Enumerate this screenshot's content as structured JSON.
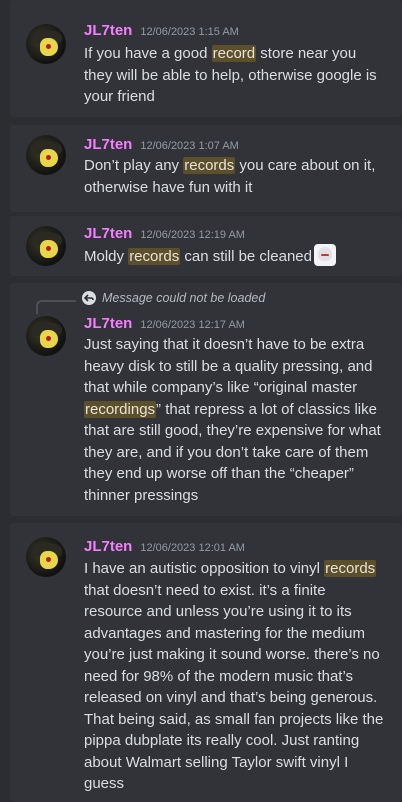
{
  "messages": [
    {
      "author": "JL7ten",
      "timestamp": "12/06/2023 1:15 AM",
      "text_parts": [
        "If you have a good ",
        "record",
        " store near you they will be able to help, otherwise google is your friend"
      ]
    },
    {
      "author": "JL7ten",
      "timestamp": "12/06/2023 1:07 AM",
      "text_parts": [
        "Don’t play any ",
        "records",
        " you care about on it, otherwise have fun with it"
      ]
    },
    {
      "author": "JL7ten",
      "timestamp": "12/06/2023 12:19 AM",
      "text_parts": [
        "Moldy ",
        "records",
        " can still be cleaned"
      ],
      "emoji": "anime-girl-emoji"
    },
    {
      "reply_text": "Message could not be loaded",
      "author": "JL7ten",
      "timestamp": "12/06/2023 12:17 AM",
      "text_parts": [
        "Just saying that it doesn’t have to be extra heavy disk to still be a quality pressing, and that while company’s like “original master ",
        "recordings",
        "” that repress a lot of classics like that are still good, they’re expensive for what they are, and if you don’t take care of them they end up worse off than the “cheaper” thinner pressings"
      ]
    },
    {
      "author": "JL7ten",
      "timestamp": "12/06/2023 12:01 AM",
      "text_parts": [
        "I have an autistic opposition to vinyl ",
        "records",
        " that doesn’t need to exist. it’s a finite resource and unless you’re using it to its advantages and mastering for the medium you’re just making it sound worse. there’s no need for 98% of the modern music that’s released on vinyl and that’s being generous. That being said, as small fan projects like the pippa dubplate its really cool. Just ranting about Walmart selling Taylor swift vinyl I guess"
      ]
    }
  ],
  "colors": {
    "background": "#2b2d31",
    "message_card": "#313338",
    "author": "#f47fff",
    "timestamp": "#949ba4",
    "highlight": "#5c4f2c"
  }
}
